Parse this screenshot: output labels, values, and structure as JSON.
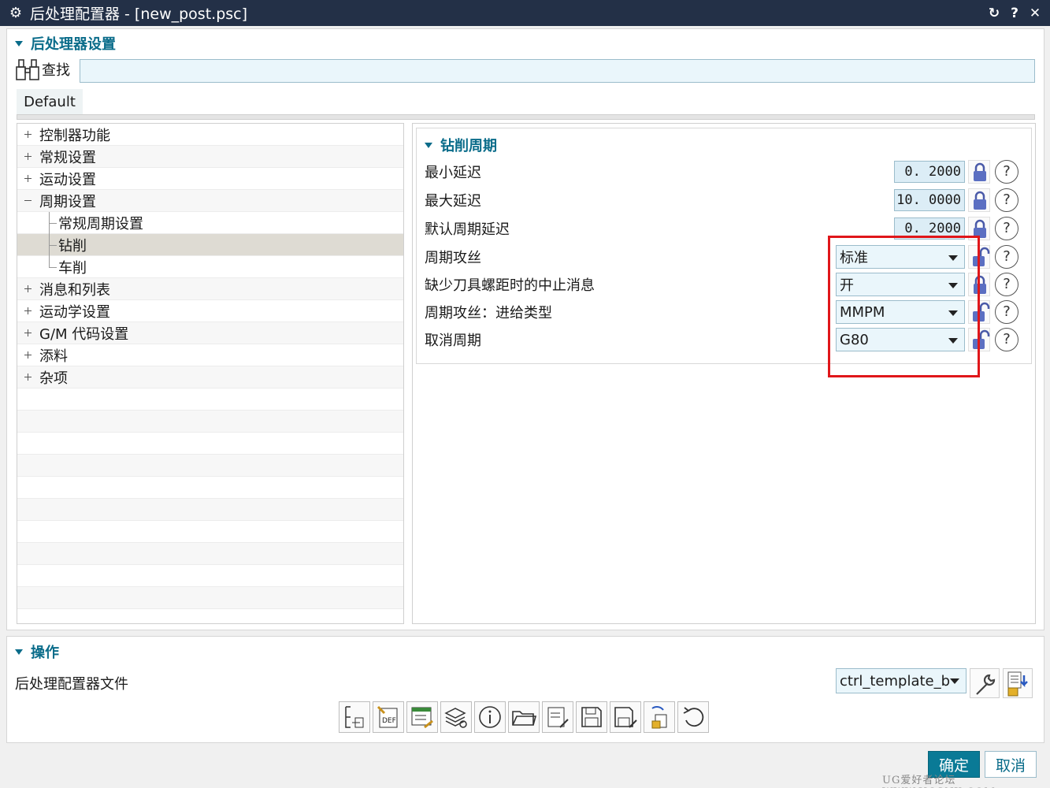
{
  "window": {
    "title": "后处理配置器 - [new_post.psc]",
    "buttons": {
      "reset": "↻",
      "help": "?",
      "close": "✕"
    }
  },
  "settings": {
    "header": "后处理器设置",
    "find_label": "查找",
    "find_value": "",
    "tab": "Default"
  },
  "tree": {
    "items": [
      {
        "label": "控制器功能",
        "level": 0,
        "expander": "plus"
      },
      {
        "label": "常规设置",
        "level": 0,
        "expander": "plus"
      },
      {
        "label": "运动设置",
        "level": 0,
        "expander": "plus"
      },
      {
        "label": "周期设置",
        "level": 0,
        "expander": "minus"
      },
      {
        "label": "常规周期设置",
        "level": 1
      },
      {
        "label": "钻削",
        "level": 1,
        "selected": true
      },
      {
        "label": "车削",
        "level": 1
      },
      {
        "label": "消息和列表",
        "level": 0,
        "expander": "plus"
      },
      {
        "label": "运动学设置",
        "level": 0,
        "expander": "plus"
      },
      {
        "label": "G/M 代码设置",
        "level": 0,
        "expander": "plus"
      },
      {
        "label": "添料",
        "level": 0,
        "expander": "plus"
      },
      {
        "label": "杂项",
        "level": 0,
        "expander": "plus"
      }
    ]
  },
  "drill": {
    "header": "钻削周期",
    "min_delay": {
      "label": "最小延迟",
      "value": "0. 2000"
    },
    "max_delay": {
      "label": "最大延迟",
      "value": "10. 0000"
    },
    "default_delay": {
      "label": "默认周期延迟",
      "value": "0. 2000"
    },
    "tapping": {
      "label": "周期攻丝",
      "value": "标准"
    },
    "abort_msg": {
      "label": "缺少刀具螺距时的中止消息",
      "value": "开"
    },
    "feed_type": {
      "label": "周期攻丝：进给类型",
      "value": "MMPM"
    },
    "cancel": {
      "label": "取消周期",
      "value": "G80"
    }
  },
  "operations": {
    "header": "操作",
    "file_label": "后处理配置器文件",
    "file_value": "ctrl_template_b"
  },
  "dialog": {
    "ok": "确定",
    "cancel": "取消"
  },
  "watermark": "UG爱好者论坛 WWW.UGSNX.COM",
  "colors": {
    "accent": "#0a6c8a",
    "highlight_box": "#e0161a",
    "titlebar": "#233047"
  }
}
